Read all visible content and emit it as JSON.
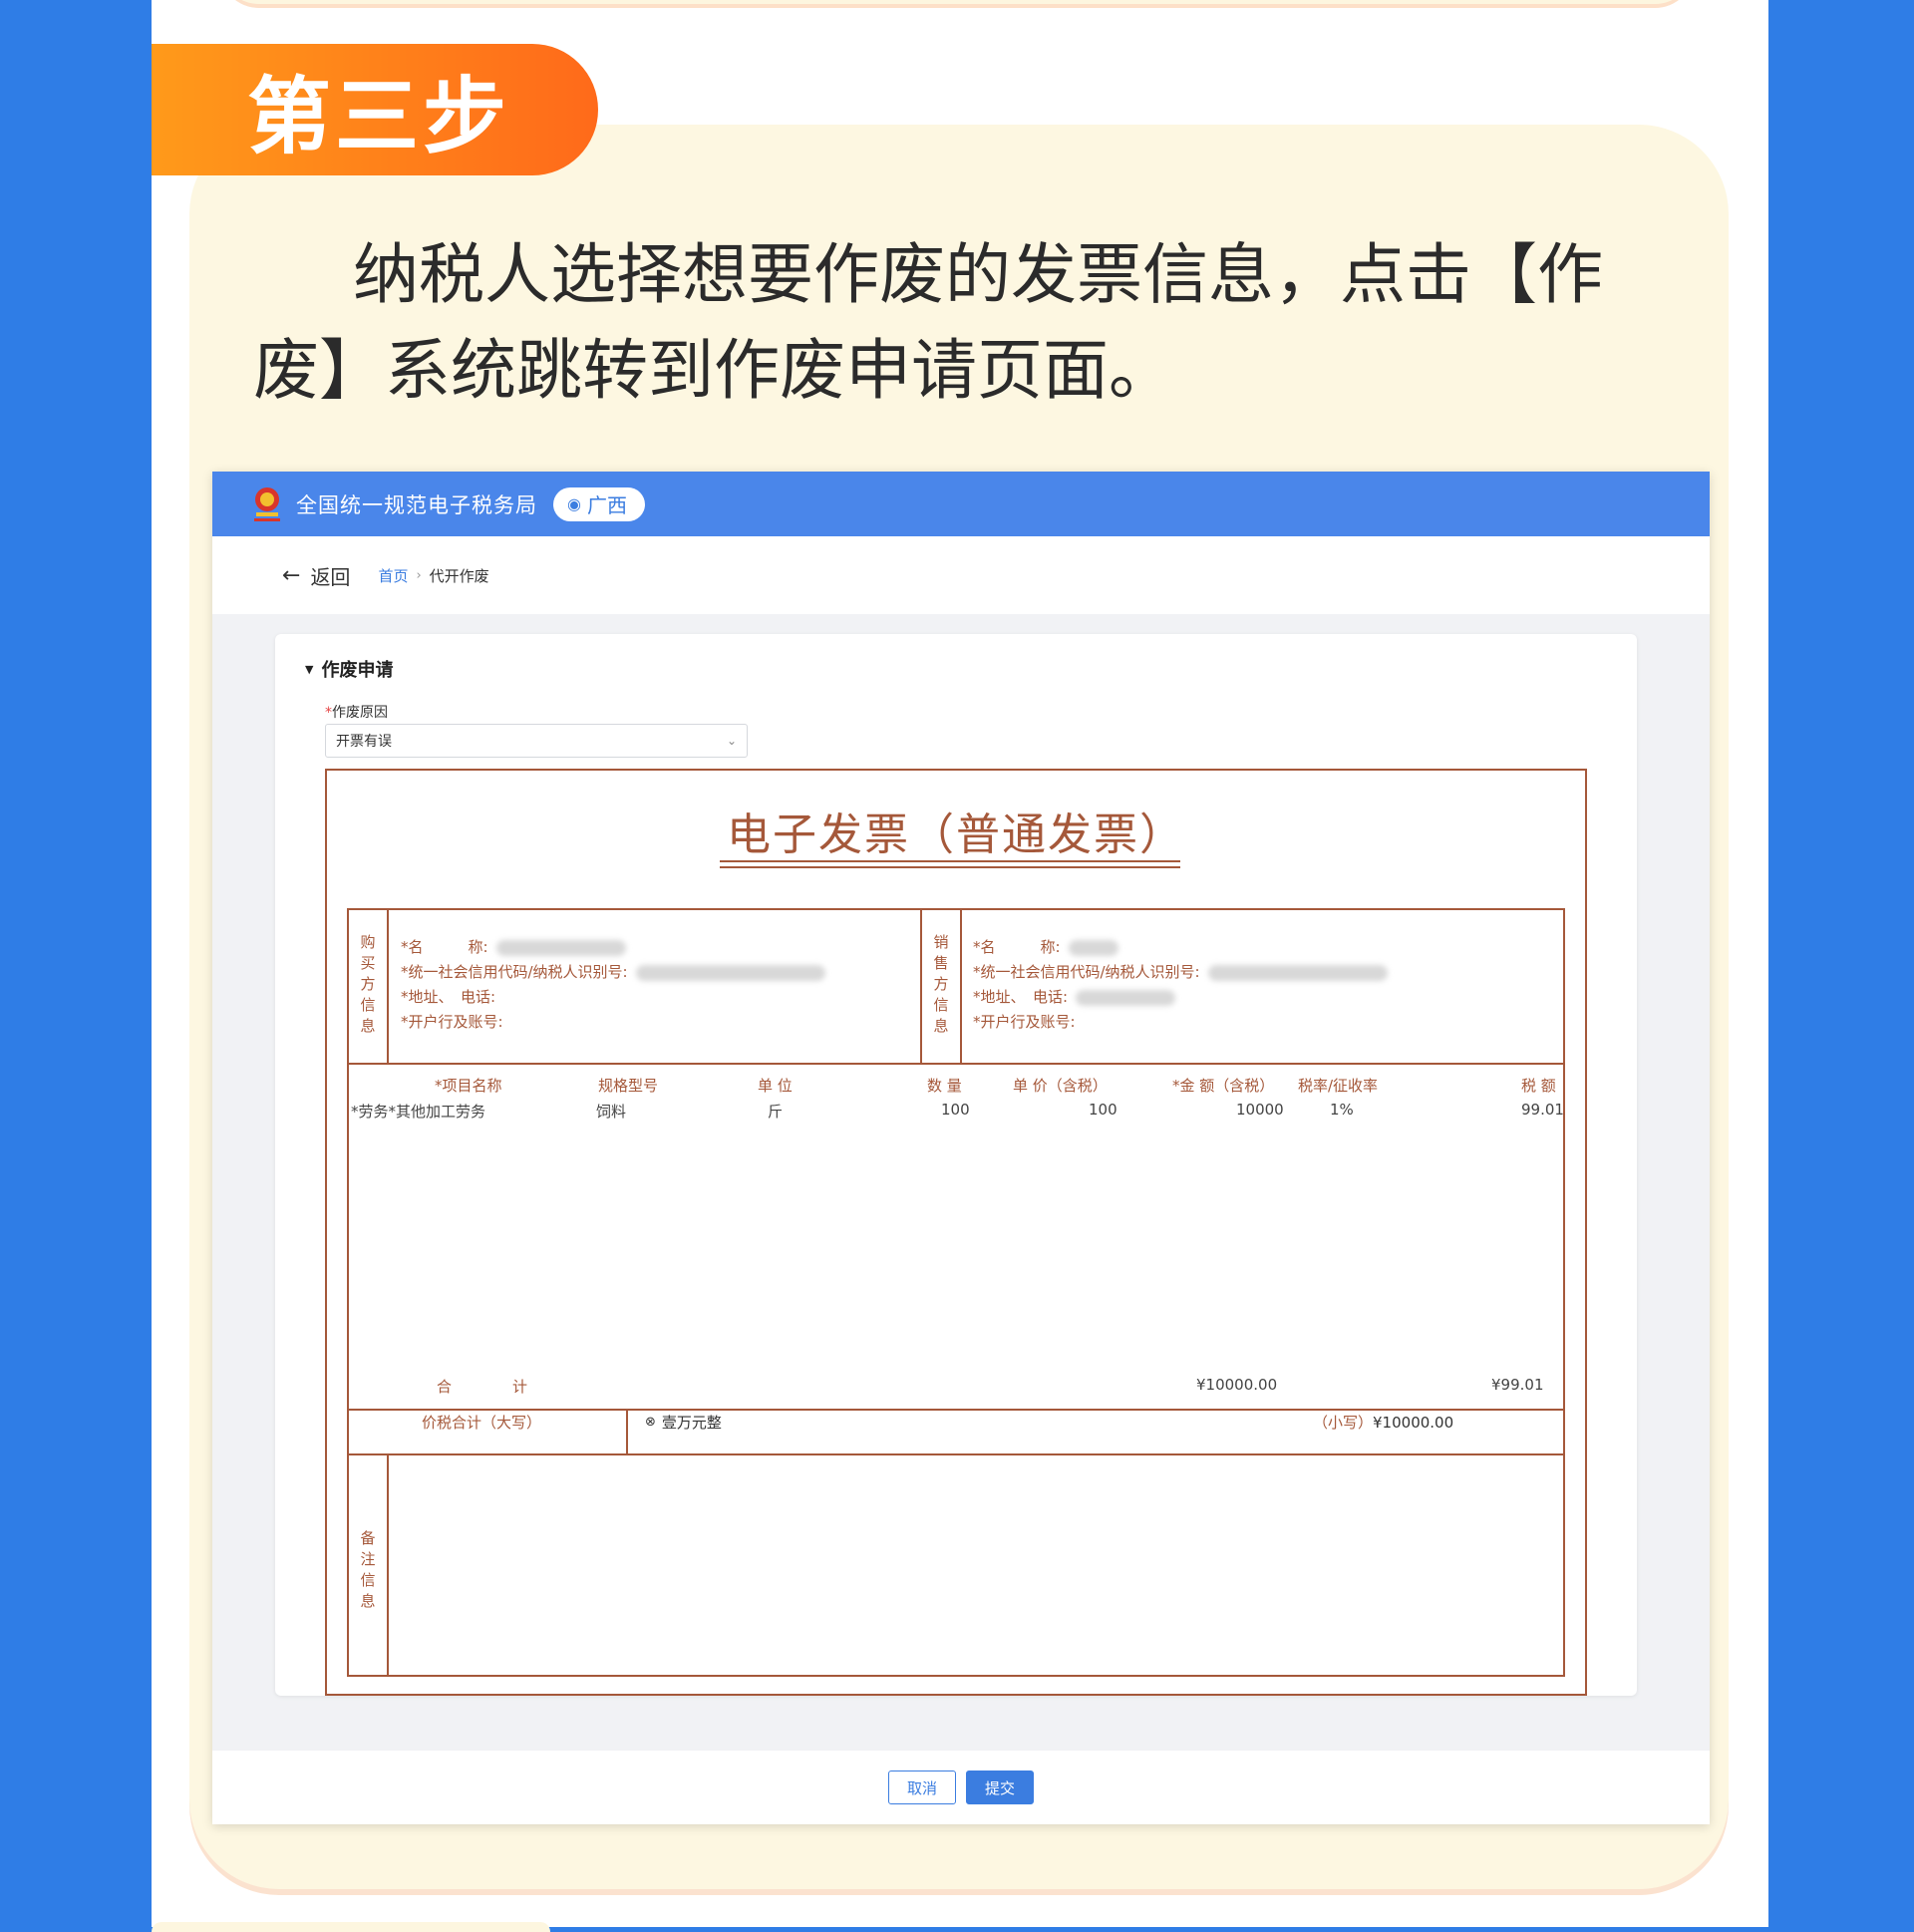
{
  "step": {
    "badge": "第三步",
    "description": "纳税人选择想要作废的发票信息，点击【作废】系统跳转到作废申请页面。"
  },
  "app": {
    "title": "全国统一规范电子税务局",
    "region": "广西",
    "back_label": "返回",
    "breadcrumb": {
      "home": "首页",
      "current": "代开作废"
    }
  },
  "form": {
    "section_title": "作废申请",
    "reason_required_mark": "*",
    "reason_label": "作废原因",
    "reason_value": "开票有误"
  },
  "invoice": {
    "title": "电子发票（普通发票）",
    "buyer_label": [
      "购",
      "买",
      "方",
      "信",
      "息"
    ],
    "seller_label": [
      "销",
      "售",
      "方",
      "信",
      "息"
    ],
    "buyer_fields": [
      "*名　　　称:",
      "*统一社会信用代码/纳税人识别号:",
      "*地址、　电话:",
      "*开户行及账号:"
    ],
    "seller_fields": [
      "*名　　　称:",
      "*统一社会信用代码/纳税人识别号:",
      "*地址、　电话:",
      "*开户行及账号:"
    ],
    "columns": [
      "*项目名称",
      "规格型号",
      "单 位",
      "数 量",
      "单 价（含税）",
      "*金 额（含税）",
      "税率/征收率",
      "税 额"
    ],
    "rows": [
      [
        "*劳务*其他加工劳务",
        "饲料",
        "斤",
        "100",
        "100",
        "10000",
        "1%",
        "99.01"
      ]
    ],
    "total_label_a": "合",
    "total_label_b": "计",
    "total_amount": "¥10000.00",
    "total_tax": "¥99.01",
    "sum_label": "价税合计（大写）",
    "sum_capital": "壹万元整",
    "sum_small_label": "（小写）",
    "sum_small_value": "¥10000.00",
    "remark_label": [
      "备",
      "注",
      "信",
      "息"
    ]
  },
  "footer": {
    "cancel": "取消",
    "submit": "提交"
  }
}
